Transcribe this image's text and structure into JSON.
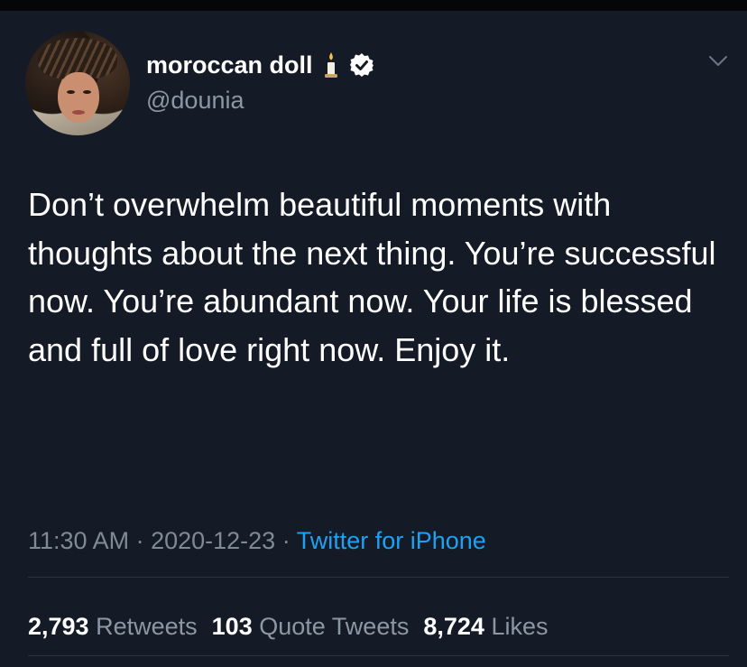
{
  "user": {
    "display_name": "moroccan doll",
    "handle": "@dounia"
  },
  "tweet": {
    "text": "Don’t overwhelm beautiful moments with thoughts about the next thing. You’re successful now. You’re abundant now. Your life is blessed and full of love right now. Enjoy it."
  },
  "meta": {
    "time": "11:30 AM",
    "separator": " · ",
    "date": "2020-12-23",
    "source": "Twitter for iPhone"
  },
  "stats": {
    "retweets_count": "2,793",
    "retweets_label": "Retweets",
    "quotes_count": "103",
    "quotes_label": "Quote Tweets",
    "likes_count": "8,724",
    "likes_label": "Likes"
  },
  "icons": {
    "name_emoji": "candle-icon",
    "badge": "verified-icon",
    "menu": "chevron-down-icon"
  },
  "colors": {
    "background": "#151b26",
    "link": "#1da1f2",
    "secondary_text": "#8c97a4"
  }
}
